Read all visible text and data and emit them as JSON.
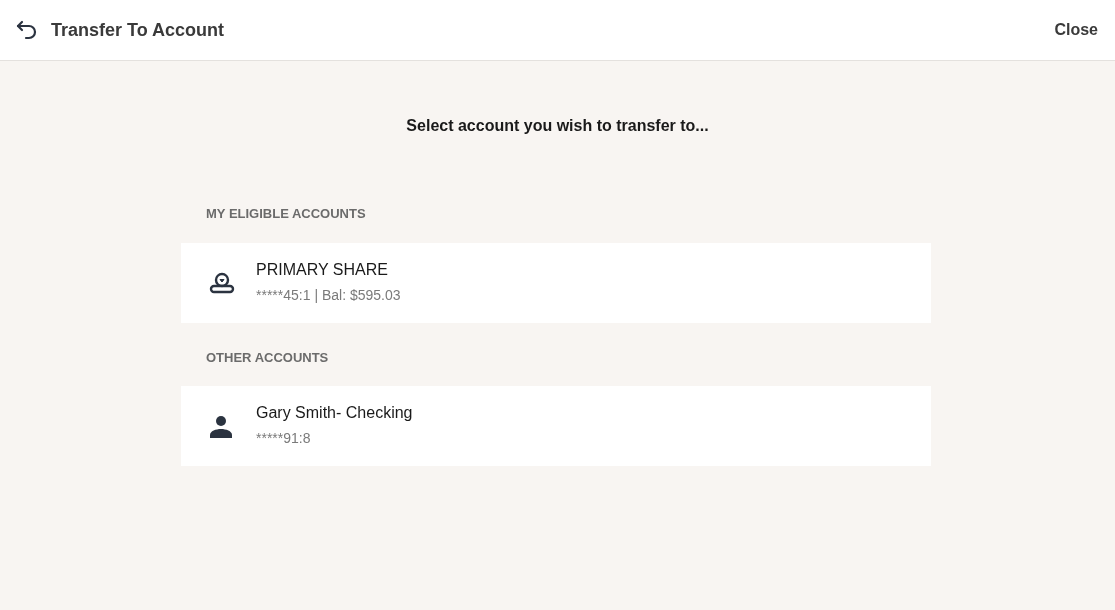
{
  "header": {
    "title": "Transfer To Account",
    "close": "Close"
  },
  "prompt": "Select account you wish to transfer to...",
  "sections": [
    {
      "heading": "MY ELIGIBLE ACCOUNTS",
      "accounts": [
        {
          "kind": "share",
          "name": "PRIMARY SHARE",
          "detail": "*****45:1 | Bal: $595.03"
        }
      ]
    },
    {
      "heading": "OTHER ACCOUNTS",
      "accounts": [
        {
          "kind": "person",
          "name": "Gary Smith- Checking",
          "detail": "*****91:8"
        }
      ]
    }
  ]
}
